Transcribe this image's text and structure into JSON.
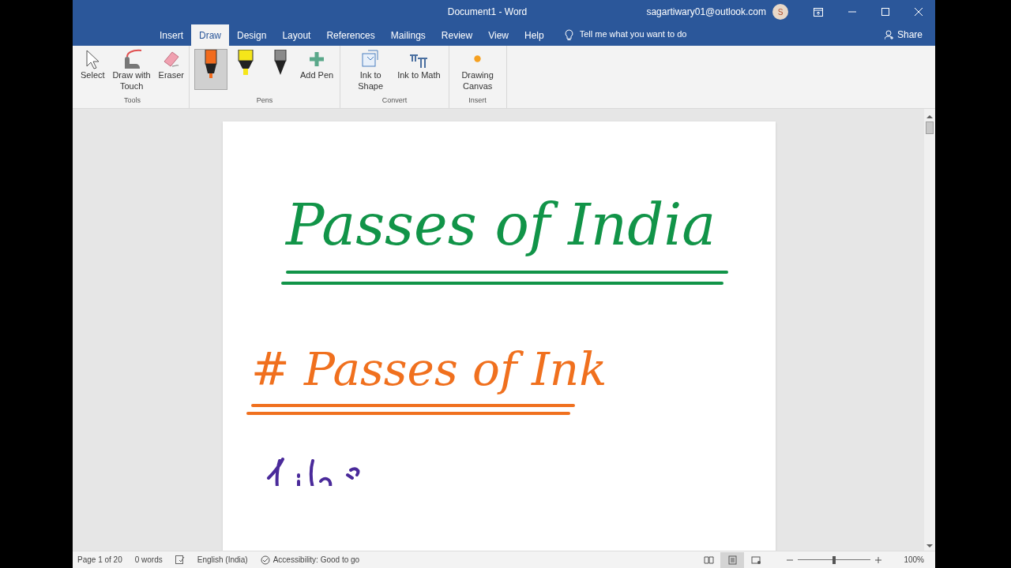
{
  "window": {
    "title": "Document1  -  Word",
    "account": "sagartiwary01@outlook.com",
    "avatar": "S"
  },
  "tabs": [
    {
      "label": "Insert",
      "selected": false
    },
    {
      "label": "Draw",
      "selected": true
    },
    {
      "label": "Design",
      "selected": false
    },
    {
      "label": "Layout",
      "selected": false
    },
    {
      "label": "References",
      "selected": false
    },
    {
      "label": "Mailings",
      "selected": false
    },
    {
      "label": "Review",
      "selected": false
    },
    {
      "label": "View",
      "selected": false
    },
    {
      "label": "Help",
      "selected": false
    }
  ],
  "tell_me": {
    "placeholder": "Tell me what you want to do"
  },
  "share": "Share",
  "ribbon": {
    "tools": {
      "label": "Tools",
      "items": [
        {
          "kind": "select",
          "label": "Select"
        },
        {
          "kind": "touch",
          "label": "Draw with Touch"
        },
        {
          "kind": "eraser",
          "label": "Eraser"
        }
      ]
    },
    "pens": {
      "label": "Pens",
      "items": [
        {
          "kind": "pen",
          "color": "#f26b1d",
          "selected": true
        },
        {
          "kind": "highlighter",
          "color": "#f5e61a",
          "selected": false
        },
        {
          "kind": "pencil",
          "color": "#8a8a8a",
          "selected": false
        }
      ],
      "add": "Add Pen"
    },
    "convert": {
      "label": "Convert",
      "items": [
        {
          "kind": "shape",
          "label": "Ink to Shape"
        },
        {
          "kind": "math",
          "label": "Ink to Math"
        }
      ]
    },
    "insert": {
      "label": "Insert",
      "items": [
        {
          "kind": "canvas",
          "label": "Drawing Canvas"
        }
      ]
    }
  },
  "ink": [
    {
      "text": "Passes of India",
      "color": "#119448"
    },
    {
      "text": "# Passes of Ink",
      "color": "#f0701e"
    }
  ],
  "status_bar": {
    "page": "Page 1 of 20",
    "words": "0 words",
    "language": "English (India)",
    "accessibility": "Accessibility: Good to go",
    "views": [
      {
        "kind": "read",
        "selected": false
      },
      {
        "kind": "print",
        "selected": true
      },
      {
        "kind": "web",
        "selected": false
      }
    ],
    "zoom_slider": {
      "level": 0.5
    },
    "zoom": "100%"
  }
}
